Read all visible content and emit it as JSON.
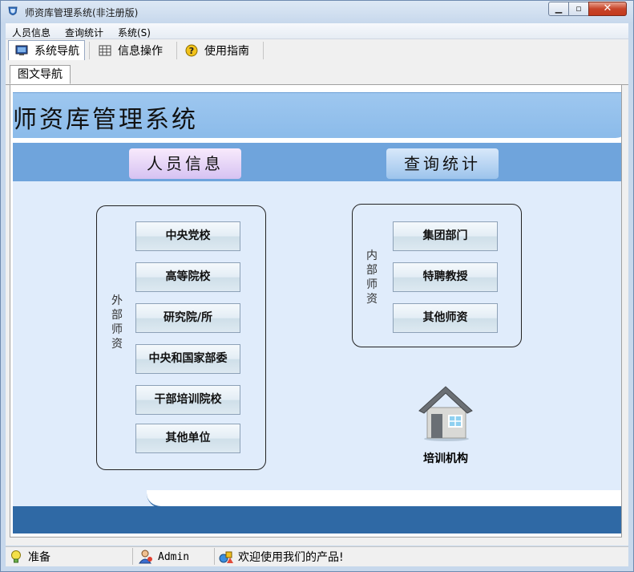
{
  "window": {
    "title": "师资库管理系统(非注册版)",
    "min_label": "▁",
    "max_label": "▫",
    "close_label": "✕"
  },
  "menu": {
    "items": [
      "人员信息",
      "查询统计",
      "系统(S)"
    ]
  },
  "toolbar": {
    "buttons": [
      "系统导航",
      "信息操作",
      "使用指南"
    ]
  },
  "doc_tab": {
    "label": "图文导航"
  },
  "banner": {
    "title": "师资库管理系统"
  },
  "nav": {
    "people": "人员信息",
    "query": "查询统计"
  },
  "external": {
    "label": [
      "外",
      "部",
      "师",
      "资"
    ],
    "buttons": [
      "中央党校",
      "高等院校",
      "研究院/所",
      "中央和国家部委",
      "干部培训院校",
      "其他单位"
    ]
  },
  "internal": {
    "label": [
      "内",
      "部",
      "师",
      "资"
    ],
    "buttons": [
      "集团部门",
      "特聘教授",
      "其他师资"
    ]
  },
  "training": {
    "label": "培训机构"
  },
  "status": {
    "state": "准备",
    "user": "Admin",
    "message": "欢迎使用我们的产品!"
  },
  "colors": {
    "banner": "#8bbbea",
    "navbar": "#6fa4dc",
    "body": "#e0ecfb",
    "footer": "#2f69a5"
  }
}
